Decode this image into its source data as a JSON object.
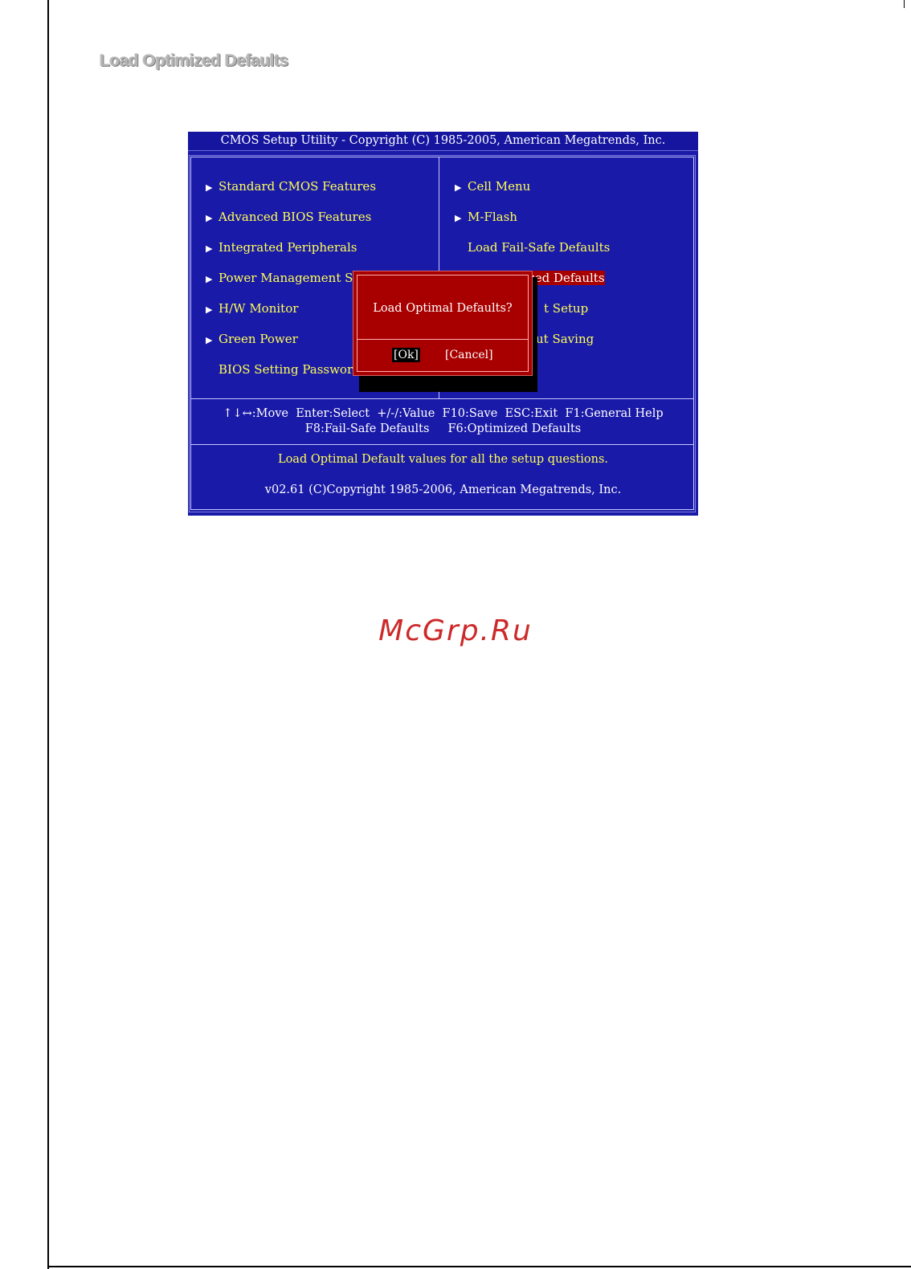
{
  "section_title": "Load Optimized Defaults",
  "bios": {
    "title": "CMOS Setup Utility - Copyright (C) 1985-2005, American Megatrends, Inc.",
    "left_menu": [
      {
        "label": "Standard CMOS Features",
        "arrow": "▶"
      },
      {
        "label": "Advanced BIOS Features",
        "arrow": "▶"
      },
      {
        "label": "Integrated Peripherals",
        "arrow": "▶"
      },
      {
        "label": "Power Management Setu",
        "arrow": "▶"
      },
      {
        "label": "H/W Monitor",
        "arrow": "▶"
      },
      {
        "label": "Green Power",
        "arrow": "▶"
      },
      {
        "label": "BIOS Setting Password",
        "arrow": ""
      }
    ],
    "right_menu": [
      {
        "label": "Cell Menu",
        "arrow": "▶"
      },
      {
        "label": "M-Flash",
        "arrow": "▶"
      },
      {
        "label": "Load Fail-Safe Defaults",
        "arrow": ""
      },
      {
        "label": "ized Defaults",
        "arrow": ""
      },
      {
        "label": "t Setup",
        "arrow": ""
      },
      {
        "label": "ut Saving",
        "arrow": ""
      }
    ],
    "help_line1": "↑↓↔:Move  Enter:Select  +/-/:Value  F10:Save  ESC:Exit  F1:General Help",
    "help_line2": "F8:Fail-Safe Defaults     F6:Optimized Defaults",
    "description": "Load Optimal Default values for all the setup questions.",
    "version": "v02.61 (C)Copyright 1985-2006, American Megatrends, Inc.",
    "dialog": {
      "message": "Load Optimal Defaults?",
      "ok_label": "[Ok]",
      "cancel_label": "[Cancel]"
    },
    "colors": {
      "background": "#1a1aa8",
      "menu_text": "#ffff55",
      "dialog": "#a80000"
    }
  },
  "watermark": "McGrp.Ru"
}
